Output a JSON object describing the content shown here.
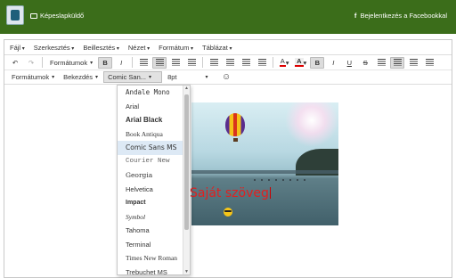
{
  "topbar": {
    "brand": "Képeslapküldő",
    "fb_icon": "f",
    "fb_login": "Bejelentkezés a Facebookkal"
  },
  "menubar": [
    "Fájl",
    "Szerkesztés",
    "Beillesztés",
    "Nézet",
    "Formátum",
    "Táblázat"
  ],
  "toolbar1": {
    "undo_icon": "↶",
    "redo_icon": "↷",
    "formats": "Formátumok",
    "bold": "B",
    "italic": "I",
    "color_a": "A",
    "bold2": "B",
    "italic2": "I",
    "underline": "U",
    "strike": "S"
  },
  "toolbar2": {
    "formats": "Formátumok",
    "indent": "Bekezdés",
    "font": "Comic San...",
    "size": "8pt",
    "smiley": "☺"
  },
  "fontlist": {
    "items": [
      "Andale Mono",
      "Arial",
      "Arial Black",
      "Book Antiqua",
      "Comic Sans MS",
      "Courier New",
      "Georgia",
      "Helvetica",
      "Impact",
      "Symbol",
      "Tahoma",
      "Terminal",
      "Times New Roman",
      "Trebuchet MS"
    ],
    "selected": "Comic Sans MS",
    "scroll_up": "▲",
    "scroll_down": "▼"
  },
  "content": {
    "caption": "Saját szöveg"
  },
  "colors": {
    "topbar": "#3b6d1a",
    "caption": "#e02020",
    "selection": "#dde9f5"
  }
}
